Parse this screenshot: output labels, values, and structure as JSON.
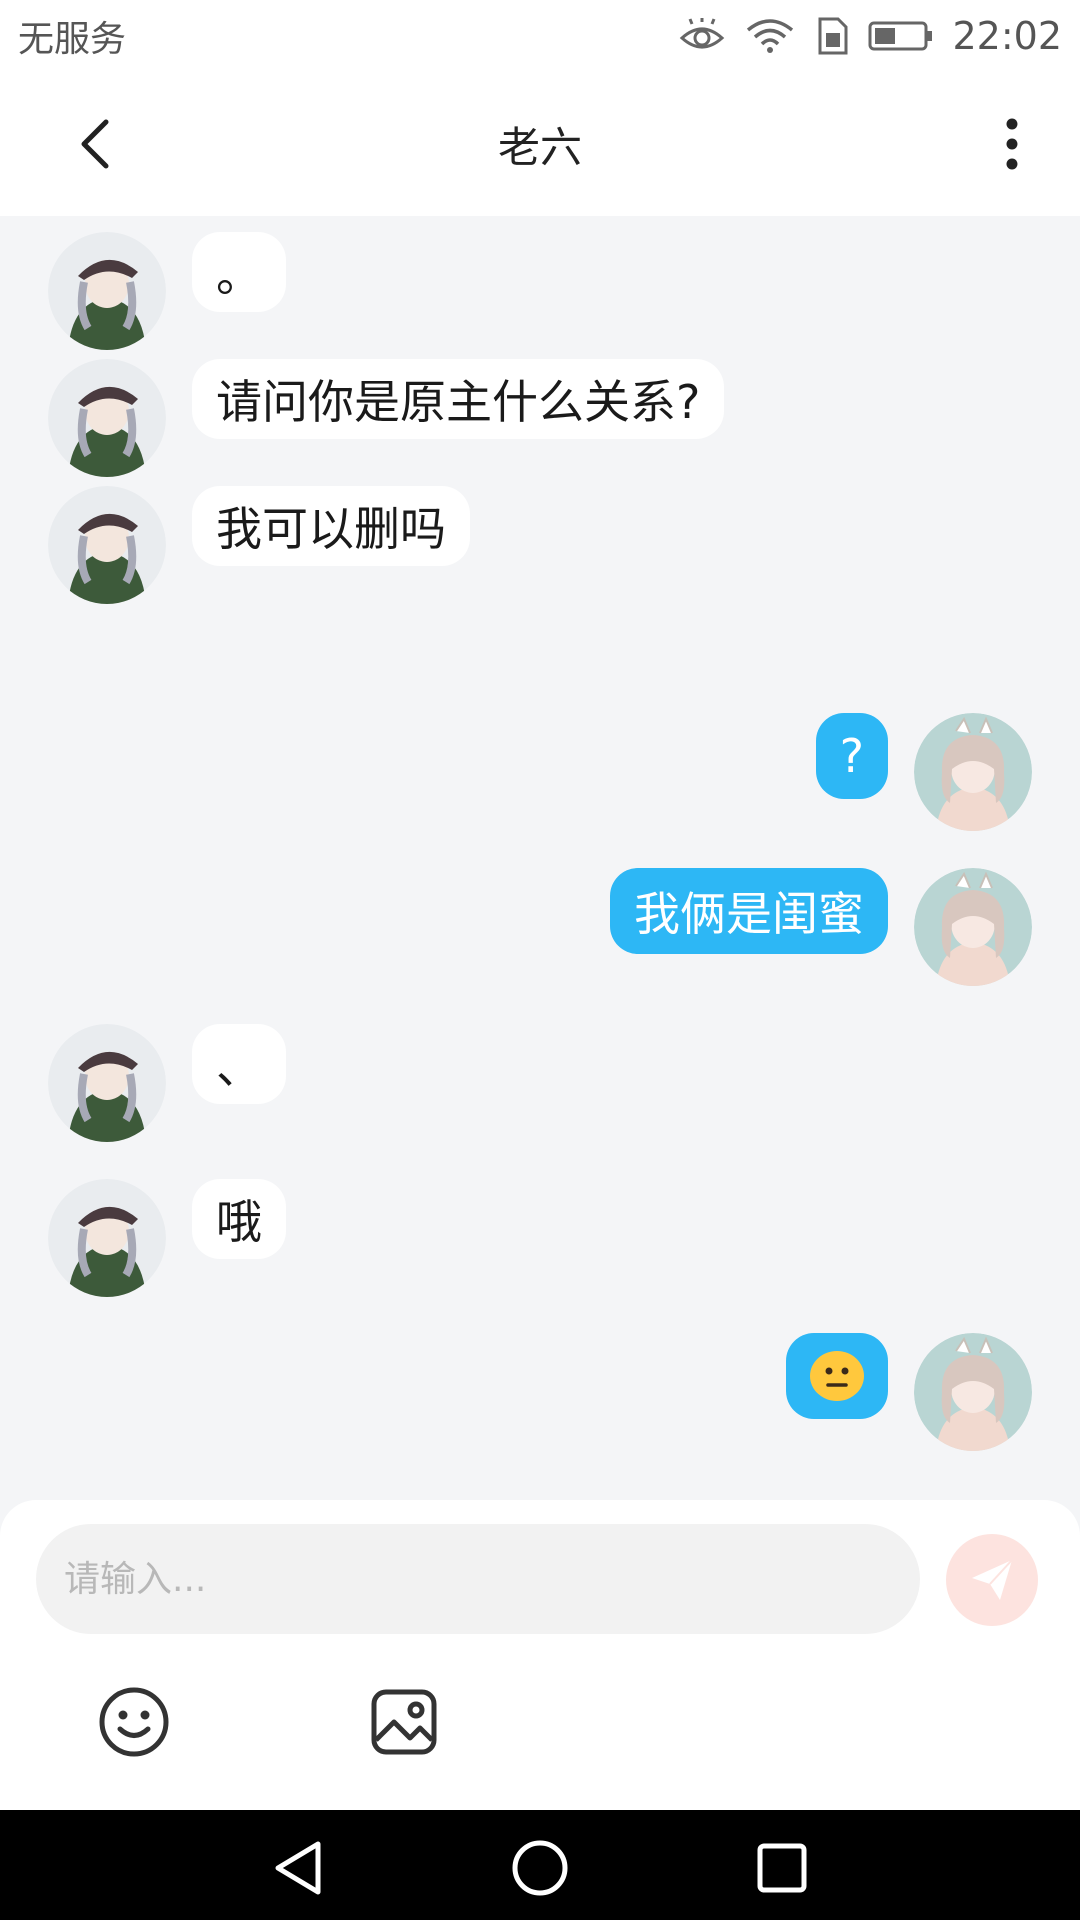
{
  "status_bar": {
    "carrier": "无服务",
    "time": "22:02",
    "icons": [
      "eye-icon",
      "wifi-icon",
      "sim-icon",
      "battery-icon"
    ]
  },
  "header": {
    "title": "老六",
    "back_icon": "chevron-left-icon",
    "more_icon": "more-vertical-icon"
  },
  "messages": [
    {
      "side": "them",
      "text": "。"
    },
    {
      "side": "them",
      "text": "请问你是原主什么关系?"
    },
    {
      "side": "them",
      "text": "我可以删吗"
    },
    {
      "side": "me",
      "text": "?"
    },
    {
      "side": "me",
      "text": "我俩是闺蜜"
    },
    {
      "side": "them",
      "text": "、"
    },
    {
      "side": "them",
      "text": "哦"
    },
    {
      "side": "me",
      "text": "😐"
    }
  ],
  "composer": {
    "placeholder": "请输入...",
    "send_icon": "send-icon",
    "tools": [
      "emoji-icon",
      "image-icon"
    ]
  },
  "nav_bar": {
    "icons": [
      "back-triangle-icon",
      "home-circle-icon",
      "recent-square-icon"
    ]
  },
  "colors": {
    "my_bubble": "#2db7f5",
    "their_bubble": "#ffffff",
    "chat_background": "#f4f5f7",
    "send_button": "#fde3df"
  }
}
